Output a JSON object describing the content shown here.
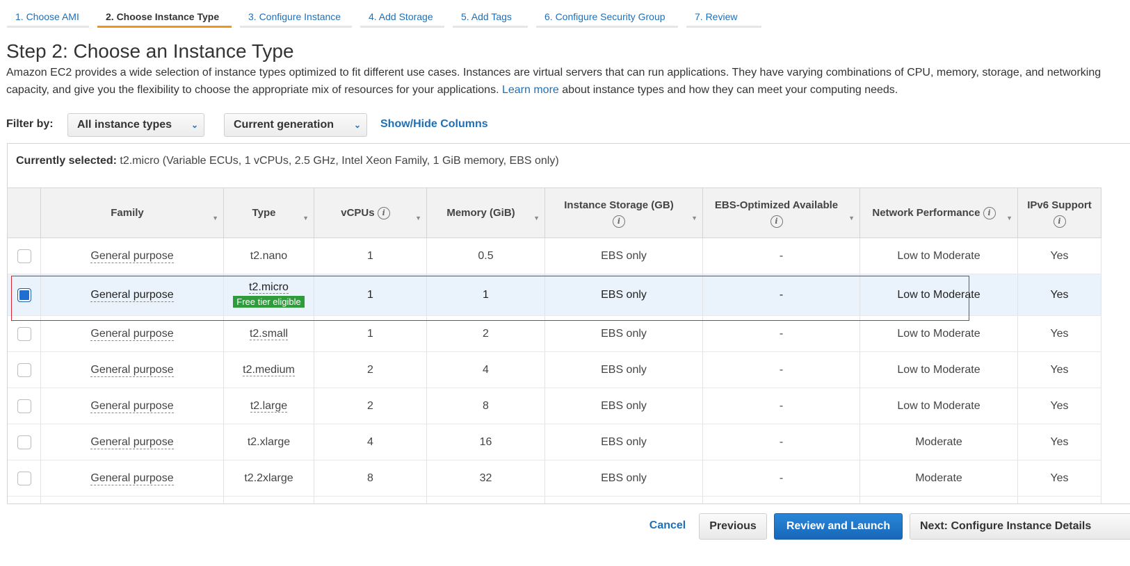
{
  "wizard": {
    "tabs": [
      {
        "label": "1. Choose AMI"
      },
      {
        "label": "2. Choose Instance Type"
      },
      {
        "label": "3. Configure Instance"
      },
      {
        "label": "4. Add Storage"
      },
      {
        "label": "5. Add Tags"
      },
      {
        "label": "6. Configure Security Group"
      },
      {
        "label": "7. Review"
      }
    ],
    "active_tab_index": 1
  },
  "page": {
    "title": "Step 2: Choose an Instance Type",
    "intro_text": "Amazon EC2 provides a wide selection of instance types optimized to fit different use cases. Instances are virtual servers that can run applications. They have varying combinations of CPU, memory, storage, and networking capacity, and give you the flexibility to choose the appropriate mix of resources for your applications.",
    "learn_more_label": "Learn more",
    "intro_suffix": "about instance types and how they can meet your computing needs."
  },
  "filter": {
    "label": "Filter by:",
    "instance_types_value": "All instance types",
    "generation_value": "Current generation",
    "show_hide_columns_label": "Show/Hide Columns"
  },
  "selection": {
    "label": "Currently selected:",
    "value": "t2.micro (Variable ECUs, 1 vCPUs, 2.5 GHz, Intel Xeon Family, 1 GiB memory, EBS only)"
  },
  "table": {
    "columns": {
      "family": "Family",
      "type": "Type",
      "vcpus": "vCPUs",
      "memory": "Memory (GiB)",
      "storage": "Instance Storage (GB)",
      "ebs": "EBS-Optimized Available",
      "network": "Network Performance",
      "ipv6": "IPv6 Support"
    },
    "rows": [
      {
        "family": "General purpose",
        "type": "t2.nano",
        "vcpus": "1",
        "memory": "0.5",
        "storage": "EBS only",
        "ebs": "-",
        "network": "Low to Moderate",
        "ipv6": "Yes",
        "selected": false
      },
      {
        "family": "General purpose",
        "type": "t2.micro",
        "badge": "Free tier eligible",
        "vcpus": "1",
        "memory": "1",
        "storage": "EBS only",
        "ebs": "-",
        "network": "Low to Moderate",
        "ipv6": "Yes",
        "selected": true
      },
      {
        "family": "General purpose",
        "type": "t2.small",
        "vcpus": "1",
        "memory": "2",
        "storage": "EBS only",
        "ebs": "-",
        "network": "Low to Moderate",
        "ipv6": "Yes",
        "selected": false
      },
      {
        "family": "General purpose",
        "type": "t2.medium",
        "vcpus": "2",
        "memory": "4",
        "storage": "EBS only",
        "ebs": "-",
        "network": "Low to Moderate",
        "ipv6": "Yes",
        "selected": false
      },
      {
        "family": "General purpose",
        "type": "t2.large",
        "vcpus": "2",
        "memory": "8",
        "storage": "EBS only",
        "ebs": "-",
        "network": "Low to Moderate",
        "ipv6": "Yes",
        "selected": false
      },
      {
        "family": "General purpose",
        "type": "t2.xlarge",
        "vcpus": "4",
        "memory": "16",
        "storage": "EBS only",
        "ebs": "-",
        "network": "Moderate",
        "ipv6": "Yes",
        "selected": false
      },
      {
        "family": "General purpose",
        "type": "t2.2xlarge",
        "vcpus": "8",
        "memory": "32",
        "storage": "EBS only",
        "ebs": "-",
        "network": "Moderate",
        "ipv6": "Yes",
        "selected": false
      }
    ]
  },
  "footer": {
    "cancel_label": "Cancel",
    "previous_label": "Previous",
    "review_launch_label": "Review and Launch",
    "next_label": "Next: Configure Instance Details"
  },
  "colors": {
    "link": "#1f6fb7",
    "active_tab_underline": "#f0941b",
    "primary_button": "#1667b8",
    "selected_row": "#eaf3fc",
    "free_tier_badge": "#2e9c3a",
    "highlight_box": "#d9232e"
  },
  "icons": {
    "info": "info-circle-icon",
    "sort": "sort-caret-icon",
    "dropdown": "chevron-down-icon"
  }
}
